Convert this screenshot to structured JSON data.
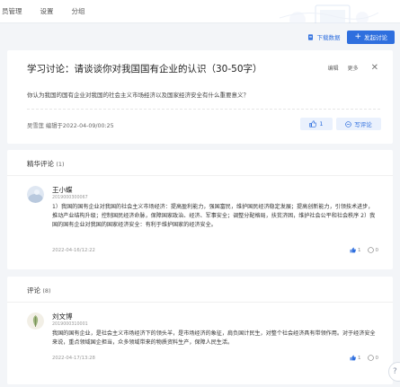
{
  "nav": {
    "items": [
      "员管理",
      "设置",
      "分组"
    ]
  },
  "toolbar": {
    "download_label": "下载数据",
    "publish_label": "发起讨论"
  },
  "discussion": {
    "title": "学习讨论：请谈谈你对我国国有企业的认识（30-50字）",
    "actions": {
      "edit": "编辑",
      "more": "更多"
    },
    "question": "你认为我国的国有企业对我国的社会主义市场经济以及国家经济安全有什么重要意义？",
    "author_line": "吴雪莲 编辑于2022-04-09/00:25",
    "like_count": "1",
    "write_label": "写评论"
  },
  "best": {
    "title": "精华评论",
    "count": "(1)",
    "comment": {
      "name": "王小蝶",
      "id": "2019000300067",
      "text": "1）我国的国有企业对我国的社会主义市场经济：提高盈利能力，强国富民，维护国民经济稳定发展；提高创新能力，引领技术进步，推动产业结构升级；控制国民经济命脉，保障国家政治、经济、军事安全；调整分配格局，扶贫济困，维护社会公平和社会秩序 2）我国的国有企业对我国的国家经济安全：有利于维护国家的经济安全。",
      "date": "2022-04-16/12:22",
      "likes": "1",
      "replies": "0"
    }
  },
  "all": {
    "title": "评论",
    "count": "(8)",
    "comment": {
      "name": "刘文博",
      "id": "2019000310001",
      "text": "我国的国有企业，是社会主义市场经济下的领头羊，是市场经济的象征，肩负国计民生，对整个社会经济具有带领作用。对于经济安全来说，重点领域国企担当，众多领域带来的物质资料生产，保障人民生活。",
      "date": "2022-04-17/13:28",
      "likes": "1",
      "replies": "0"
    }
  },
  "colors": {
    "accent": "#2f6fde",
    "background": "#f3f5f8"
  }
}
